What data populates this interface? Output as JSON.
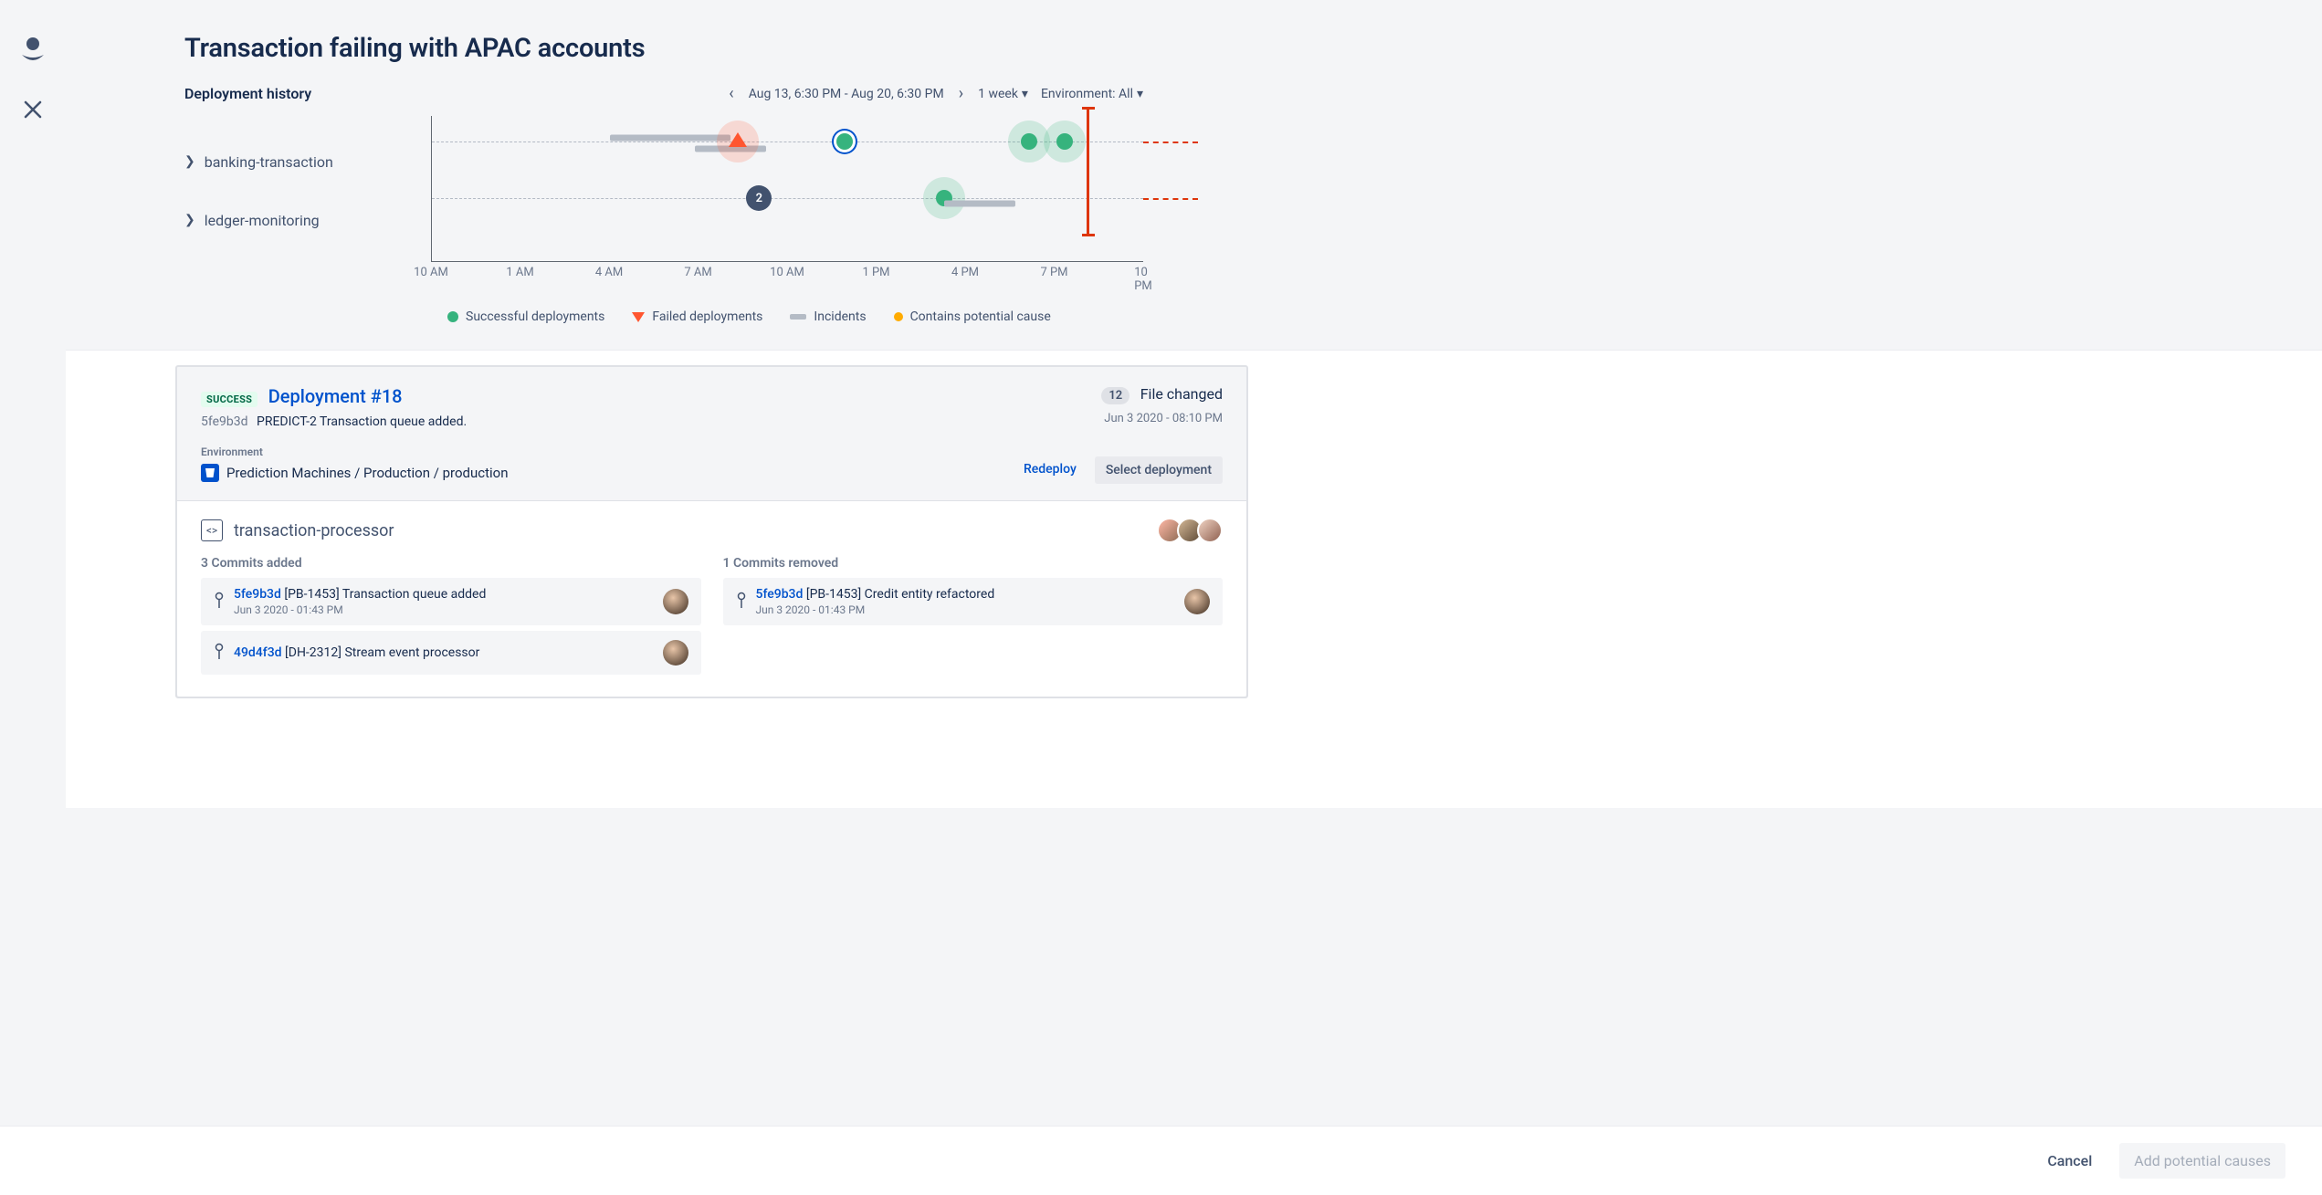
{
  "header": {
    "title": "Transaction failing with APAC accounts",
    "section_title": "Deployment history",
    "date_range": "Aug 13, 6:30 PM - Aug 20, 6:30 PM",
    "span_picker": "1 week",
    "env_picker": "Environment: All"
  },
  "series": [
    {
      "name": "banking-transaction"
    },
    {
      "name": "ledger-monitoring"
    }
  ],
  "time_axis": [
    "10 AM",
    "1 AM",
    "4 AM",
    "7 AM",
    "10 AM",
    "1 PM",
    "4 PM",
    "7 PM",
    "10 PM"
  ],
  "legend": {
    "success": "Successful deployments",
    "failed": "Failed deployments",
    "incidents": "Incidents",
    "cause": "Contains potential cause"
  },
  "cluster_count": "2",
  "deployment": {
    "status": "SUCCESS",
    "title": "Deployment #18",
    "sha": "5fe9b3d",
    "issue": "PREDICT-2",
    "message": "Transaction queue added.",
    "env_label": "Environment",
    "env_path": "Prediction Machines / Production / production",
    "files_count": "12",
    "files_label": "File changed",
    "timestamp": "Jun 3 2020 - 08:10 PM",
    "redeploy": "Redeploy",
    "select": "Select deployment"
  },
  "repo": {
    "name": "transaction-processor",
    "added_title": "3 Commits added",
    "removed_title": "1 Commits removed",
    "commits_added": [
      {
        "sha": "5fe9b3d",
        "msg": "[PB-1453] Transaction queue added",
        "ts": "Jun 3 2020 - 01:43 PM"
      },
      {
        "sha": "49d4f3d",
        "msg": "[DH-2312] Stream event processor",
        "ts": ""
      }
    ],
    "commits_removed": [
      {
        "sha": "5fe9b3d",
        "msg": "[PB-1453] Credit entity refactored",
        "ts": "Jun 3 2020 - 01:43 PM"
      }
    ]
  },
  "footer": {
    "cancel": "Cancel",
    "add": "Add potential causes"
  }
}
